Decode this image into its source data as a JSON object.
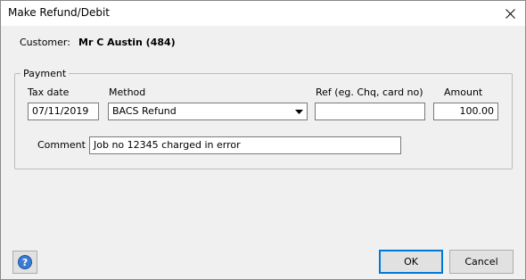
{
  "window": {
    "title": "Make Refund/Debit"
  },
  "customer": {
    "label": "Customer:",
    "value": "Mr C Austin (484)"
  },
  "payment": {
    "group_label": "Payment",
    "tax_date": {
      "label": "Tax date",
      "value": "07/11/2019"
    },
    "method": {
      "label": "Method",
      "value": "BACS Refund"
    },
    "ref": {
      "label": "Ref (eg. Chq, card no)",
      "value": ""
    },
    "amount": {
      "label": "Amount",
      "value": "100.00"
    },
    "comment": {
      "label": "Comment",
      "value": "Job no 12345 charged in error"
    }
  },
  "buttons": {
    "ok": "OK",
    "cancel": "Cancel"
  },
  "icons": {
    "close": "close-icon",
    "help": "help-icon",
    "dropdown": "chevron-down-icon"
  },
  "colors": {
    "accent": "#0078d7",
    "help_icon": "#3a7bd5"
  }
}
